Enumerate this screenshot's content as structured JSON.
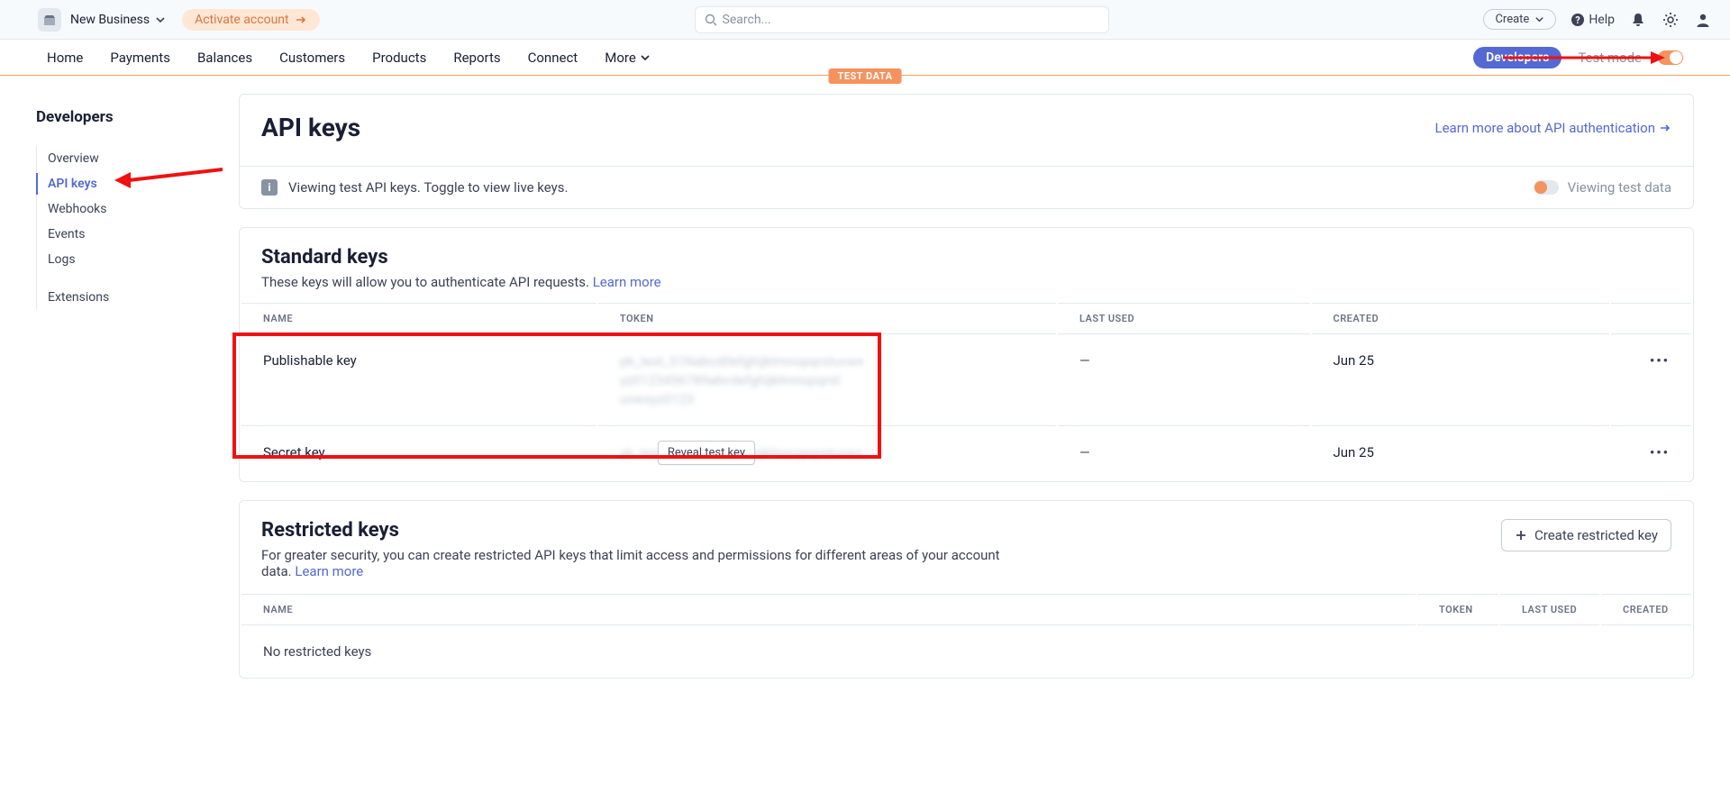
{
  "topbar": {
    "business_name": "New Business",
    "activate_label": "Activate account",
    "search_placeholder": "Search...",
    "create_label": "Create",
    "help_label": "Help"
  },
  "nav": {
    "items": [
      "Home",
      "Payments",
      "Balances",
      "Customers",
      "Products",
      "Reports",
      "Connect",
      "More"
    ],
    "developers_label": "Developers",
    "test_mode_label": "Test mode",
    "test_data_badge": "TEST DATA"
  },
  "sidebar": {
    "title": "Developers",
    "items": [
      "Overview",
      "API keys",
      "Webhooks",
      "Events",
      "Logs"
    ],
    "extra": "Extensions",
    "active_index": 1
  },
  "page": {
    "title": "API keys",
    "learn_more": "Learn more about API authentication",
    "info_text": "Viewing test API keys. Toggle to view live keys.",
    "view_test_label": "Viewing test data"
  },
  "standard": {
    "title": "Standard keys",
    "subtitle": "These keys will allow you to authenticate API requests.",
    "learn_more": "Learn more",
    "columns": [
      "NAME",
      "TOKEN",
      "LAST USED",
      "CREATED"
    ],
    "rows": [
      {
        "name": "Publishable key",
        "token_placeholder": "pk_test_51Nabcd0efghijklmnopqrstuvwx\nyz0123456789abcdefghijklmnopqrst\nuvwxyz0123",
        "last_used": "—",
        "created": "Jun 25"
      },
      {
        "name": "Secret key",
        "token_placeholder": "sk_test_51Nabcd0efghijklmnopqrstuvwx",
        "last_used": "—",
        "created": "Jun 25",
        "reveal_label": "Reveal test key"
      }
    ]
  },
  "restricted": {
    "title": "Restricted keys",
    "subtitle": "For greater security, you can create restricted API keys that limit access and permissions for different areas of your account data.",
    "learn_more": "Learn more",
    "create_label": "Create restricted key",
    "columns": [
      "NAME",
      "TOKEN",
      "LAST USED",
      "CREATED"
    ],
    "empty": "No restricted keys"
  }
}
